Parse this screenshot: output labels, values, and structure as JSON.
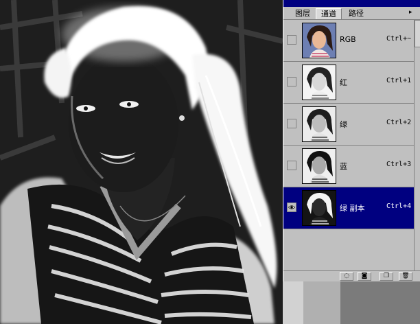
{
  "palette": {
    "tabs": [
      {
        "label": "图层"
      },
      {
        "label": "通道"
      },
      {
        "label": "路径"
      }
    ],
    "menu_arrow": "▸",
    "channels": [
      {
        "name": "RGB",
        "shortcut": "Ctrl+~",
        "visible": false,
        "selected": false
      },
      {
        "name": "红",
        "shortcut": "Ctrl+1",
        "visible": false,
        "selected": false
      },
      {
        "name": "绿",
        "shortcut": "Ctrl+2",
        "visible": false,
        "selected": false
      },
      {
        "name": "蓝",
        "shortcut": "Ctrl+3",
        "visible": false,
        "selected": false
      },
      {
        "name": "绿 副本",
        "shortcut": "Ctrl+4",
        "visible": true,
        "selected": true
      }
    ],
    "footer": {
      "load_selection_icon": "◌",
      "save_selection_icon": "◙",
      "new_channel_icon": "❐",
      "delete_channel_icon": "🗑"
    }
  },
  "colors": {
    "selected_row": "#000080",
    "panel_gray": "#c0c0c0"
  }
}
